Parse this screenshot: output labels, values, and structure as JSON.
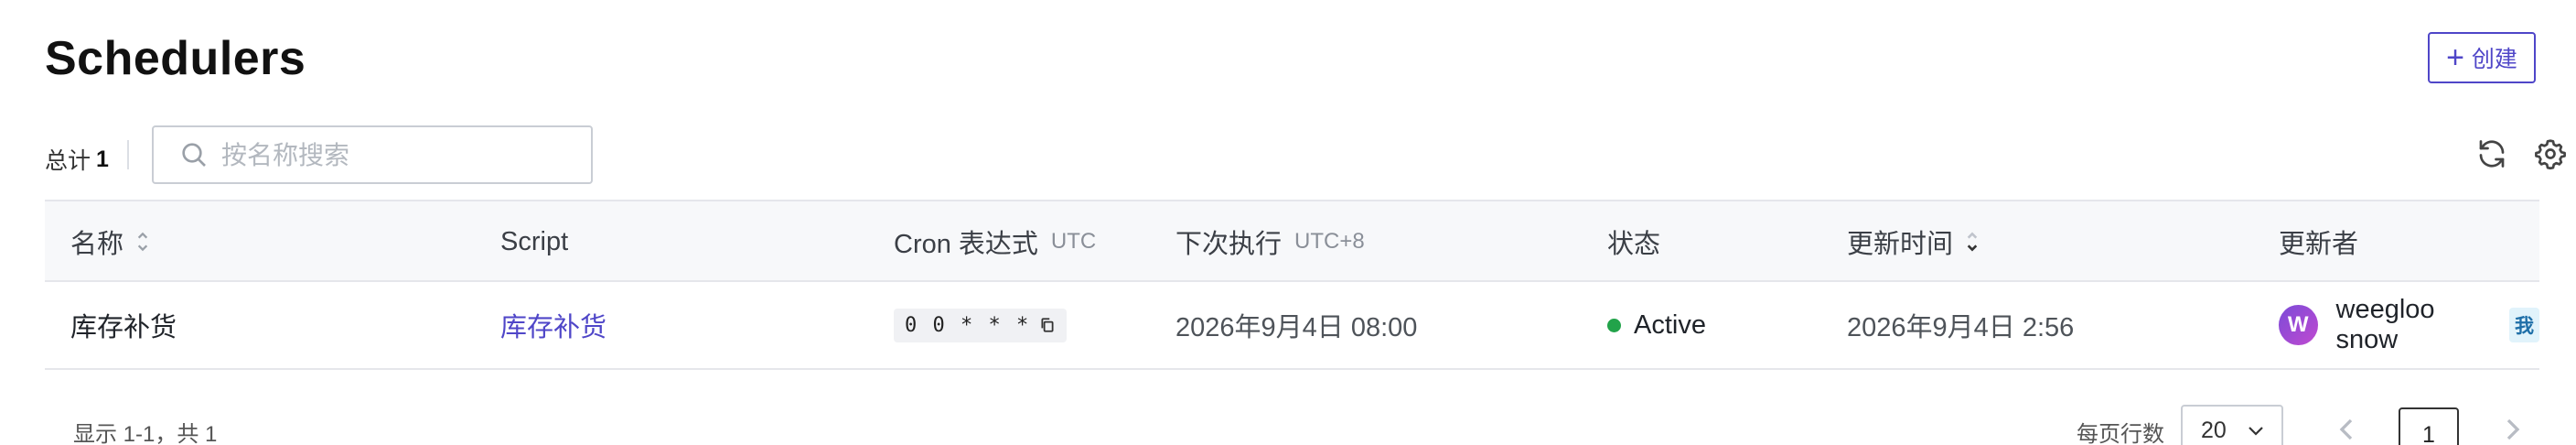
{
  "header": {
    "title": "Schedulers",
    "create_label": "创建"
  },
  "toolbar": {
    "total_label": "总计",
    "total_count": "1",
    "search_placeholder": "按名称搜索"
  },
  "table": {
    "columns": {
      "name": "名称",
      "script": "Script",
      "cron": "Cron 表达式",
      "cron_sub": "UTC",
      "next_run": "下次执行",
      "next_run_sub": "UTC+8",
      "status": "状态",
      "updated_at": "更新时间",
      "updated_by": "更新者"
    },
    "rows": [
      {
        "name": "库存补货",
        "script": "库存补货",
        "cron": "0 0 * * *",
        "next_run": "2026年9月4日 08:00",
        "status": "Active",
        "updated_at": "2026年9月4日 2:56",
        "updated_by": "weegloo snow",
        "avatar_letter": "W",
        "me_badge": "我"
      }
    ]
  },
  "footer": {
    "range_text": "显示 1-1，共 1",
    "page_size_label": "每页行数",
    "page_size": "20",
    "current_page": "1"
  },
  "colors": {
    "accent": "#4f46c8",
    "status_active": "#22a34a"
  }
}
